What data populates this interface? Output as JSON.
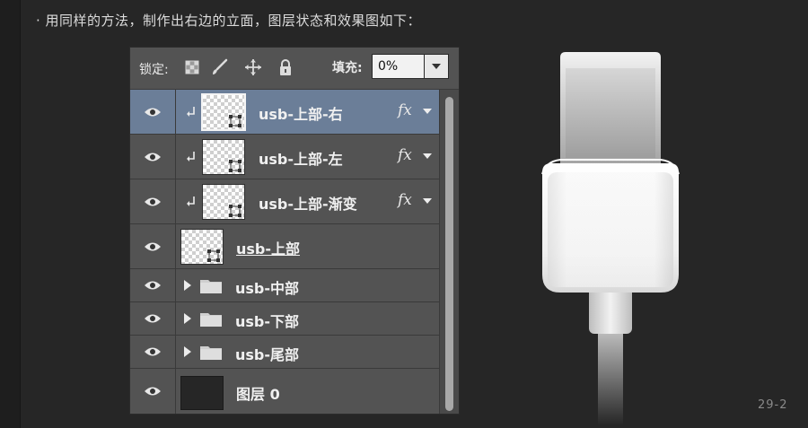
{
  "caption": "· 用同样的方法，制作出右边的立面，图层状态和效果图如下：",
  "panel": {
    "lock_label": "锁定:",
    "fill_label": "填充:",
    "fill_value": "0%"
  },
  "layers": [
    {
      "name": "usb-上部-右",
      "fx": "fx"
    },
    {
      "name": "usb-上部-左",
      "fx": "fx"
    },
    {
      "name": "usb-上部-渐变",
      "fx": "fx"
    },
    {
      "name": "usb-上部"
    },
    {
      "name": "usb-中部"
    },
    {
      "name": "usb-下部"
    },
    {
      "name": "usb-尾部"
    },
    {
      "name": "图层 0"
    }
  ],
  "figure_label": "29-2",
  "colors": {
    "background": "#262626",
    "panel": "#535353",
    "selected_row": "#6b7e98"
  }
}
